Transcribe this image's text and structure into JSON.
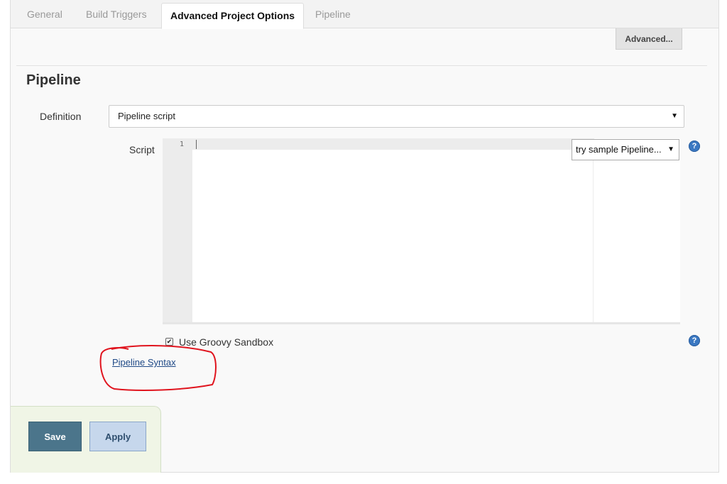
{
  "tabs": [
    {
      "label": "General",
      "active": false
    },
    {
      "label": "Build Triggers",
      "active": false
    },
    {
      "label": "Advanced Project Options",
      "active": true
    },
    {
      "label": "Pipeline",
      "active": false
    }
  ],
  "advanced_button": "Advanced...",
  "section": {
    "title": "Pipeline"
  },
  "definition": {
    "label": "Definition",
    "value": "Pipeline script"
  },
  "script": {
    "label": "Script",
    "line_number": "1",
    "sample_select": "try sample Pipeline..."
  },
  "sandbox": {
    "label": "Use Groovy Sandbox",
    "checked": true
  },
  "syntax_link": "Pipeline Syntax",
  "buttons": {
    "save": "Save",
    "apply": "Apply"
  },
  "icons": {
    "help": "help-icon",
    "caret": "caret-down-icon",
    "check": "check-icon"
  },
  "colors": {
    "save_bg": "#4b758b",
    "apply_bg": "#c6d7ec",
    "link": "#204a87",
    "annotation": "#e0141e",
    "help": "#3b78c2"
  }
}
